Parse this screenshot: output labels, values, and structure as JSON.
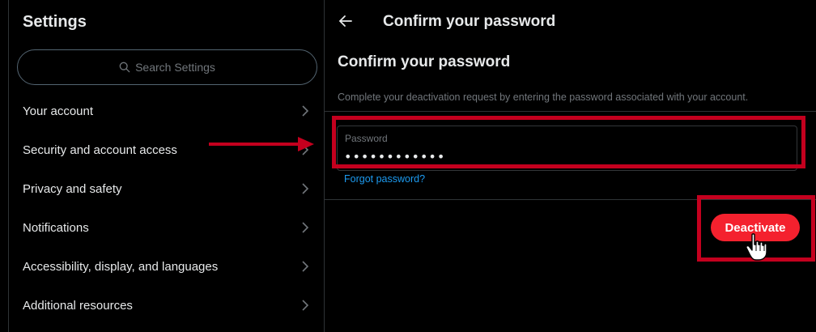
{
  "sidebar": {
    "title": "Settings",
    "search_placeholder": "Search Settings",
    "items": [
      {
        "label": "Your account"
      },
      {
        "label": "Security and account access"
      },
      {
        "label": "Privacy and safety"
      },
      {
        "label": "Notifications"
      },
      {
        "label": "Accessibility, display, and languages"
      },
      {
        "label": "Additional resources"
      }
    ]
  },
  "header": {
    "back_icon": "arrow-left-icon",
    "title": "Confirm your password"
  },
  "main": {
    "section_title": "Confirm your password",
    "description": "Complete your deactivation request by entering the password associated with your account.",
    "password_label": "Password",
    "password_value": "••••••••••••",
    "forgot_link": "Forgot password?",
    "deactivate_label": "Deactivate"
  },
  "colors": {
    "background": "#000000",
    "text": "#e7e9ea",
    "muted": "#71767b",
    "link": "#1d9bf0",
    "danger": "#f4212e",
    "annotation": "#c4001e"
  }
}
